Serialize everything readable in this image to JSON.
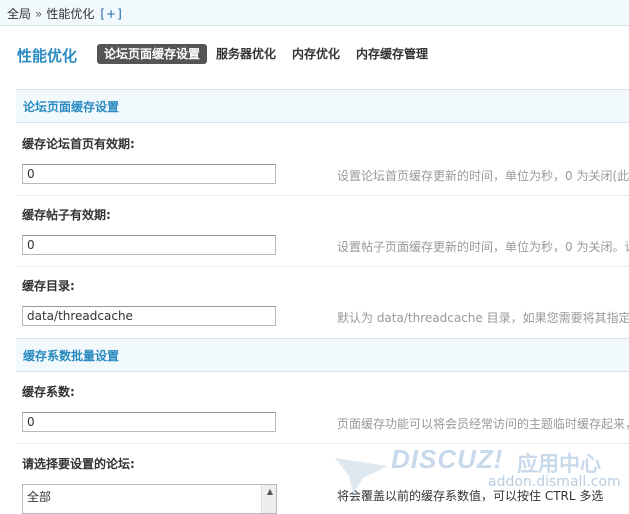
{
  "breadcrumb": {
    "root": "全局",
    "separator": "»",
    "current": "性能优化",
    "add_label": "[+]"
  },
  "page_title": "性能优化",
  "tabs": [
    {
      "label": "论坛页面缓存设置",
      "active": true
    },
    {
      "label": "服务器优化",
      "active": false
    },
    {
      "label": "内存优化",
      "active": false
    },
    {
      "label": "内存缓存管理",
      "active": false
    }
  ],
  "section1": {
    "title": "论坛页面缓存设置"
  },
  "fields": [
    {
      "label": "缓存论坛首页有效期:",
      "value": "0",
      "hint": "设置论坛首页缓存更新的时间，单位为秒，0 为关闭(此"
    },
    {
      "label": "缓存帖子有效期:",
      "value": "0",
      "hint": "设置帖子页面缓存更新的时间，单位为秒，0 为关闭。请"
    },
    {
      "label": "缓存目录:",
      "value": "data/threadcache",
      "hint": "默认为 data/threadcache 目录，如果您需要将其指定"
    }
  ],
  "section2": {
    "title": "缓存系数批量设置"
  },
  "coef": {
    "label": "缓存系数:",
    "value": "0",
    "hint": "页面缓存功能可以将会员经常访问的主题临时缓存起来，"
  },
  "forum_select": {
    "label": "请选择要设置的论坛:",
    "selected": "全部",
    "hint": "将会覆盖以前的缓存系数值，可以按住 CTRL 多选"
  },
  "watermark": {
    "brand": "DISCUZ!",
    "cn": "应用中心",
    "url": "addon.dismall.com"
  },
  "colors": {
    "accent": "#2b8bc0",
    "tab_active_bg": "#555555",
    "section_bg": "#f2f9fd"
  }
}
